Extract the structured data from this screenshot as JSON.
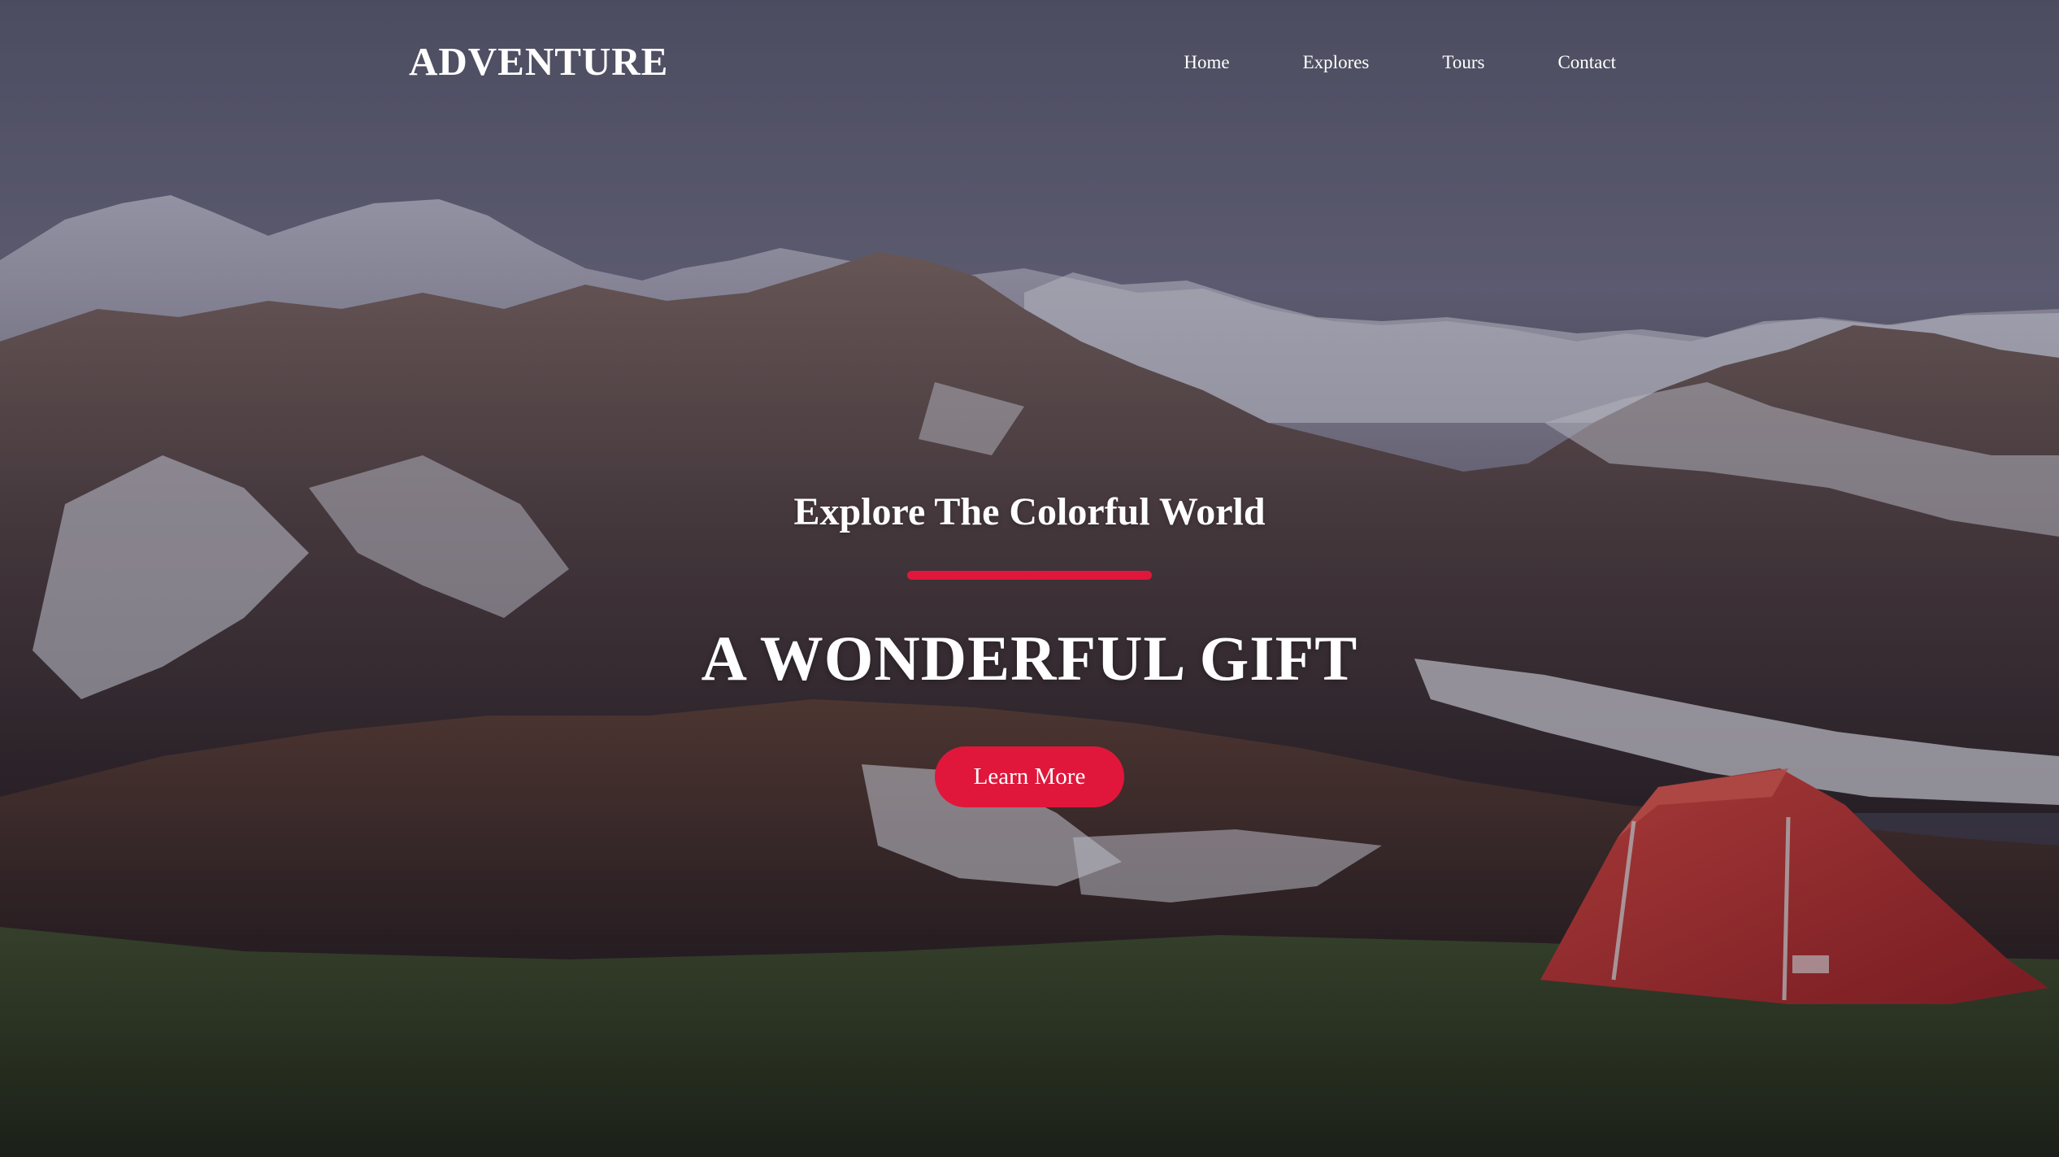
{
  "brand": {
    "logo_text": "ADVENTURE"
  },
  "nav": {
    "items": [
      {
        "label": "Home"
      },
      {
        "label": "Explores"
      },
      {
        "label": "Tours"
      },
      {
        "label": "Contact"
      }
    ]
  },
  "hero": {
    "subtitle": "Explore The Colorful World",
    "headline": "A WONDERFUL GIFT",
    "cta_label": "Learn More",
    "background_description_icon": "mountain-landscape-with-red-tent-image"
  },
  "colors": {
    "accent": "#e0173b",
    "text": "#ffffff"
  }
}
